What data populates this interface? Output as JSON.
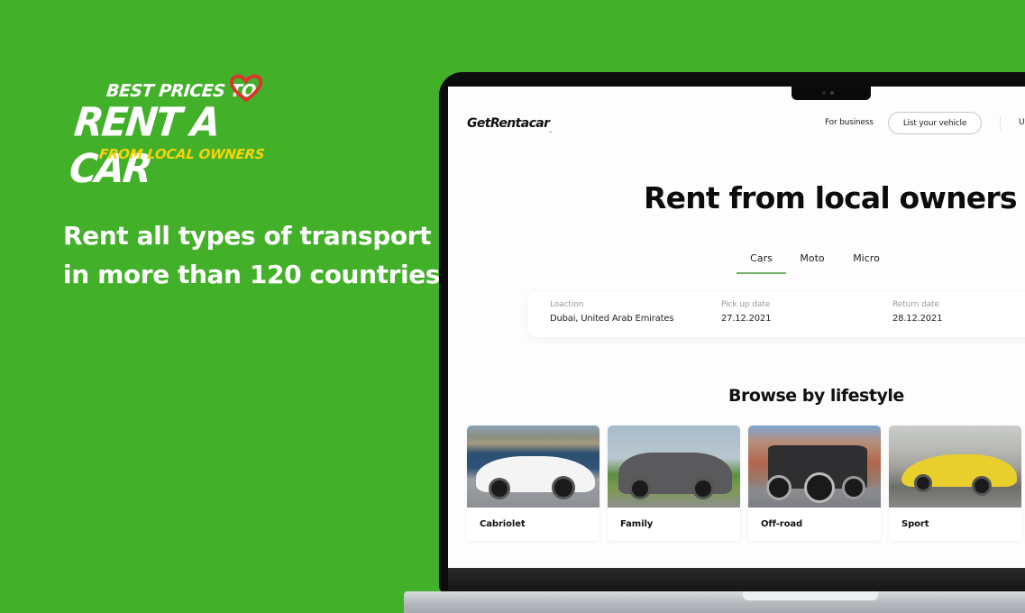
{
  "promo": {
    "line1": "BEST PRICES TO",
    "line2": "RENT A CAR",
    "line3": "FROM LOCAL OWNERS",
    "heart_icon": "heart-icon",
    "tagline": [
      "Rent all types of transport",
      "in more than 120 countries"
    ],
    "colors": {
      "background": "#43b02a",
      "accent_yellow": "#f5d40c",
      "heart_red": "#e0312b"
    }
  },
  "site": {
    "logo": "GetRentacar",
    "logo_suffix": "com",
    "nav": {
      "for_business": "For business",
      "list_vehicle": "List your vehicle",
      "user_truncated": "U"
    },
    "hero_title": "Rent from local owners",
    "tabs": [
      {
        "label": "Cars",
        "active": true
      },
      {
        "label": "Moto",
        "active": false
      },
      {
        "label": "Micro",
        "active": false
      }
    ],
    "search": {
      "location": {
        "label": "Loaction",
        "value": "Dubai, United Arab Emirates"
      },
      "pickup": {
        "label": "Pick up date",
        "value": "27.12.2021"
      },
      "return": {
        "label": "Return date",
        "value": "28.12.2021"
      }
    },
    "section_title": "Browse by lifestyle",
    "categories": [
      {
        "label": "Cabriolet",
        "image": "white convertible sports car by the sea"
      },
      {
        "label": "Family",
        "image": "grey SUV with trees"
      },
      {
        "label": "Off-road",
        "image": "black off-road jeep in desert canyon"
      },
      {
        "label": "Sport",
        "image": "yellow supercar on road"
      }
    ],
    "accent_color": "#6fb563"
  }
}
